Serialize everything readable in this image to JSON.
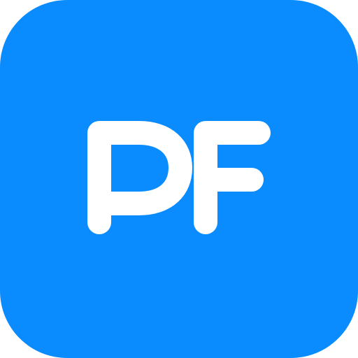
{
  "icon": {
    "name": "pf-app-icon",
    "text": "PF",
    "background_color": "#0A8CFF",
    "glyph_color": "#FFFFFF"
  }
}
